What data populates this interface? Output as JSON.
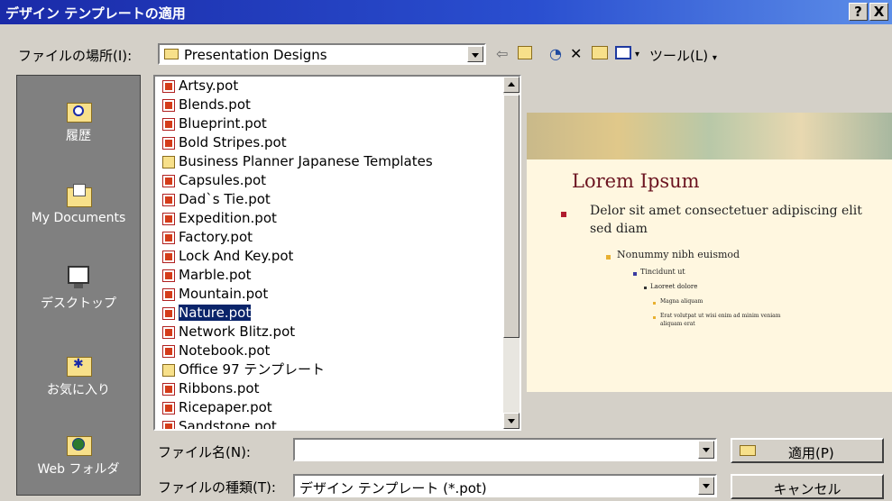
{
  "title": "デザイン テンプレートの適用",
  "title_buttons": [
    "?",
    "X"
  ],
  "lookin": {
    "label": "ファイルの場所(I):",
    "value": "Presentation Designs"
  },
  "toolbar": {
    "tools_label": "ツール(L)"
  },
  "places": [
    {
      "label": "履歴",
      "icon": "history-icon"
    },
    {
      "label": "My Documents",
      "icon": "my-documents-icon"
    },
    {
      "label": "デスクトップ",
      "icon": "desktop-icon"
    },
    {
      "label": "お気に入り",
      "icon": "favorites-icon"
    },
    {
      "label": "Web フォルダ",
      "icon": "web-folders-icon"
    }
  ],
  "files": [
    {
      "name": "Artsy.pot",
      "type": "pot"
    },
    {
      "name": "Blends.pot",
      "type": "pot"
    },
    {
      "name": "Blueprint.pot",
      "type": "pot"
    },
    {
      "name": "Bold Stripes.pot",
      "type": "pot"
    },
    {
      "name": "Business Planner Japanese Templates",
      "type": "folder"
    },
    {
      "name": "Capsules.pot",
      "type": "pot"
    },
    {
      "name": "Dad`s Tie.pot",
      "type": "pot"
    },
    {
      "name": "Expedition.pot",
      "type": "pot"
    },
    {
      "name": "Factory.pot",
      "type": "pot"
    },
    {
      "name": "Lock And Key.pot",
      "type": "pot"
    },
    {
      "name": "Marble.pot",
      "type": "pot"
    },
    {
      "name": "Mountain.pot",
      "type": "pot"
    },
    {
      "name": "Nature.pot",
      "type": "pot",
      "selected": true
    },
    {
      "name": "Network Blitz.pot",
      "type": "pot"
    },
    {
      "name": "Notebook.pot",
      "type": "pot"
    },
    {
      "name": "Office 97 テンプレート",
      "type": "folder"
    },
    {
      "name": "Ribbons.pot",
      "type": "pot"
    },
    {
      "name": "Ricepaper.pot",
      "type": "pot"
    },
    {
      "name": "Sandstone.pot",
      "type": "pot"
    }
  ],
  "preview": {
    "title": "Lorem Ipsum",
    "bullet1": "Delor sit amet consectetuer adipiscing elit",
    "bullet1b": "sed diam",
    "bullet2": "Nonummy nibh euismod",
    "bullet3": "Tincidunt ut",
    "bullet4": "Laoreet dolore",
    "bullet5": "Magna aliquam",
    "bullet6": "Erat volutpat ut wisi enim ad minim veniam",
    "bullet6b": "aliquam erat"
  },
  "filename": {
    "label": "ファイル名(N):",
    "value": ""
  },
  "filetype": {
    "label": "ファイルの種類(T):",
    "value": "デザイン テンプレート (*.pot)"
  },
  "buttons": {
    "apply": "適用(P)",
    "cancel": "キャンセル"
  },
  "colors": {
    "title_bar": "#1a2aa8",
    "selection": "#0a246a",
    "places_bg": "#808080",
    "preview_title": "#6b1420"
  }
}
